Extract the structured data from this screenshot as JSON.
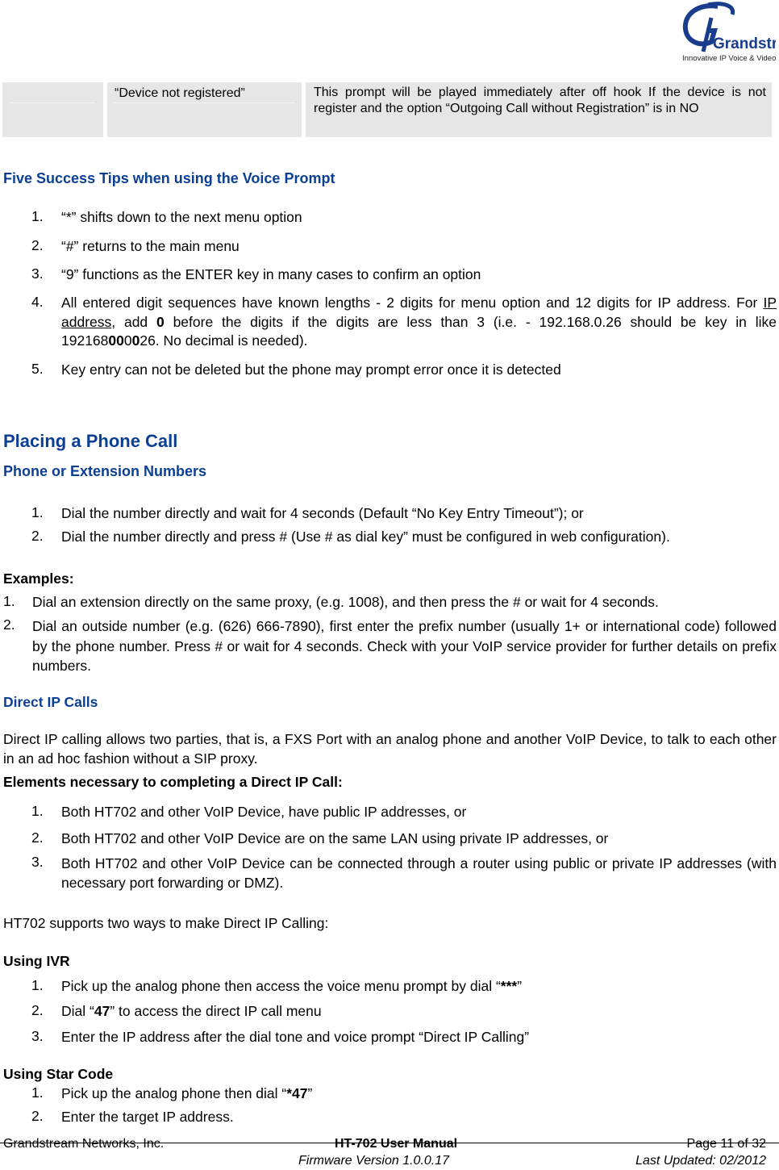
{
  "logo": {
    "brand": "Grandstream",
    "tagline": "Innovative IP Voice & Video",
    "color": "#1a3c8c"
  },
  "table_row": {
    "col1": "",
    "col2": "“Device not registered”",
    "col3": "This prompt will be played immediately after off hook If the device is not register and the option “Outgoing Call without Registration” is in NO"
  },
  "tips": {
    "heading": "Five Success Tips when using the Voice Prompt",
    "items": [
      {
        "num": "1.",
        "text": "“*” shifts down to the next menu option"
      },
      {
        "num": "2.",
        "text": "“#” returns to the main menu"
      },
      {
        "num": "3.",
        "text": "“9” functions as the ENTER key in many cases to confirm an option"
      },
      {
        "num": "4.",
        "text_a": "All entered digit sequences have known lengths - 2 digits for menu option and 12 digits for IP address. For ",
        "link": "IP address",
        "text_b": ", add ",
        "bold_zero": "0",
        "text_c": " before the digits if the digits are less than 3 (i.e. - 192.168.0.26 should be key in like 192168",
        "b1": "00",
        "n1": "0",
        "b2": "0",
        "text_d": "26.  No decimal is needed)."
      },
      {
        "num": "5.",
        "text": "Key entry can not be deleted but the phone may prompt error once it is detected"
      }
    ]
  },
  "placing": {
    "title": "Placing a Phone Call",
    "subheading": "Phone or Extension Numbers",
    "items": [
      {
        "num": "1.",
        "text": "Dial the number directly and wait for 4 seconds (Default “No Key Entry Timeout”);  or"
      },
      {
        "num": "2.",
        "text": "Dial the number directly and press # (Use # as dial key” must be configured in web configuration)."
      }
    ],
    "examples_label": "Examples:",
    "examples": [
      {
        "num": "1.",
        "text": "Dial an extension directly on the same proxy, (e.g. 1008), and then press the # or wait for 4 seconds."
      },
      {
        "num": "2.",
        "text": "Dial an outside number (e.g. (626) 666-7890), first enter the prefix number (usually 1+ or international code) followed by the phone number.  Press # or wait for 4 seconds.  Check with your VoIP service provider for further details on prefix numbers."
      }
    ]
  },
  "direct_ip": {
    "heading": "Direct IP Calls",
    "intro": "Direct IP calling allows two parties, that is, a FXS Port with an analog phone and another VoIP Device, to talk to each other in an ad hoc fashion without a SIP proxy.",
    "elements_label": "Elements necessary to completing a Direct IP Call:",
    "elements": [
      {
        "num": "1.",
        "text": "Both HT702 and other VoIP Device, have public IP addresses, or"
      },
      {
        "num": "2.",
        "text": "Both HT702 and other VoIP Device are on the same LAN using private IP addresses, or"
      },
      {
        "num": "3.",
        "text": "Both HT702 and other VoIP Device can be connected through a router using public or private IP addresses (with necessary port forwarding or DMZ)."
      }
    ],
    "ways": "HT702 supports two ways to make Direct IP Calling:",
    "ivr_label": "Using IVR",
    "ivr": [
      {
        "num": "1.",
        "text_a": "Pick up the analog phone then access the voice menu prompt by dial “",
        "bold": "***",
        "text_b": "”"
      },
      {
        "num": "2.",
        "text_a": "Dial “",
        "bold": "47",
        "text_b": "” to access the direct IP call menu"
      },
      {
        "num": "3.",
        "text_a": "Enter the IP address after the dial tone and voice prompt “Direct IP Calling”",
        "bold": "",
        "text_b": ""
      }
    ],
    "star_label": "Using Star Code",
    "star": [
      {
        "num": "1.",
        "text_a": "Pick up the analog phone then dial “",
        "bold": "*47",
        "text_b": "”"
      },
      {
        "num": "2.",
        "text_a": "Enter the target IP address.",
        "bold": "",
        "text_b": ""
      }
    ]
  },
  "footer": {
    "company": "Grandstream Networks, Inc.",
    "manual": "HT-702 User Manual",
    "firmware": "Firmware Version 1.0.0.17",
    "page": "Page 11 of 32",
    "updated": "Last Updated: 02/2012"
  }
}
